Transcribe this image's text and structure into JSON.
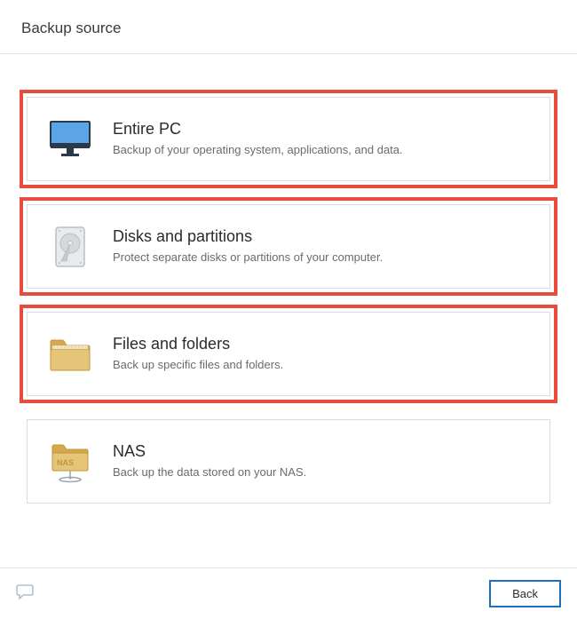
{
  "header": {
    "title": "Backup source"
  },
  "options": [
    {
      "title": "Entire PC",
      "desc": "Backup of your operating system, applications, and data.",
      "highlighted": true
    },
    {
      "title": "Disks and partitions",
      "desc": "Protect separate disks or partitions of your computer.",
      "highlighted": true
    },
    {
      "title": "Files and folders",
      "desc": "Back up specific files and folders.",
      "highlighted": true
    },
    {
      "title": "NAS",
      "desc": "Back up the data stored on your NAS.",
      "highlighted": false
    }
  ],
  "footer": {
    "back_label": "Back"
  }
}
